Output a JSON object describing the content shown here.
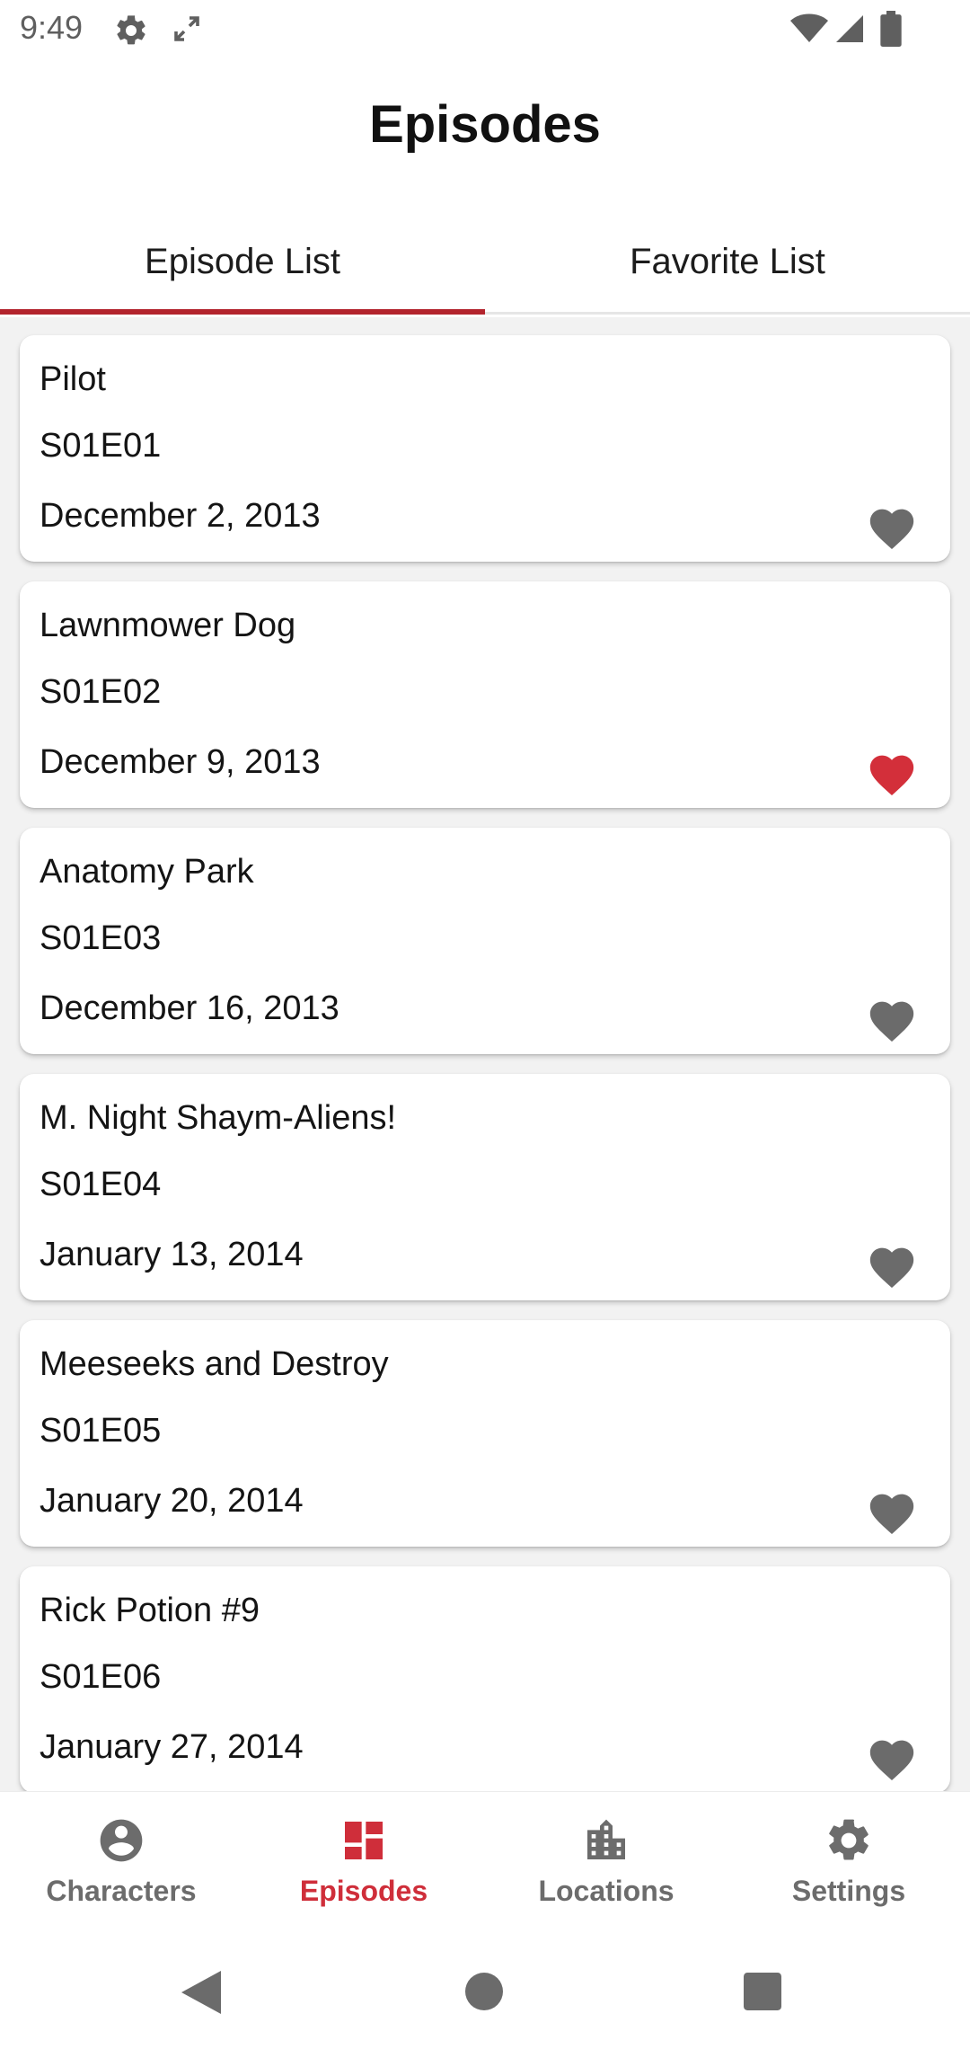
{
  "status_bar": {
    "time": "9:49"
  },
  "app_bar": {
    "title": "Episodes"
  },
  "tabs": [
    {
      "label": "Episode List",
      "selected": true
    },
    {
      "label": "Favorite List",
      "selected": false
    }
  ],
  "episodes": [
    {
      "name": "Pilot",
      "code": "S01E01",
      "air_date": "December 2, 2013",
      "favorite": false
    },
    {
      "name": "Lawnmower Dog",
      "code": "S01E02",
      "air_date": "December 9, 2013",
      "favorite": true
    },
    {
      "name": "Anatomy Park",
      "code": "S01E03",
      "air_date": "December 16, 2013",
      "favorite": false
    },
    {
      "name": "M. Night Shaym-Aliens!",
      "code": "S01E04",
      "air_date": "January 13, 2014",
      "favorite": false
    },
    {
      "name": "Meeseeks and Destroy",
      "code": "S01E05",
      "air_date": "January 20, 2014",
      "favorite": false
    },
    {
      "name": "Rick Potion #9",
      "code": "S01E06",
      "air_date": "January 27, 2014",
      "favorite": false
    }
  ],
  "bottom_nav": [
    {
      "label": "Characters",
      "icon": "account-circle-icon",
      "active": false
    },
    {
      "label": "Episodes",
      "icon": "dashboard-icon",
      "active": true
    },
    {
      "label": "Locations",
      "icon": "city-icon",
      "active": false
    },
    {
      "label": "Settings",
      "icon": "gear-icon",
      "active": false
    }
  ],
  "colors": {
    "accent": "#cf2e3a",
    "tab_indicator": "#b3242d",
    "favorite_on": "#d32f3a",
    "favorite_off": "#6b6b6b",
    "inactive_nav": "#6c6c6c"
  }
}
